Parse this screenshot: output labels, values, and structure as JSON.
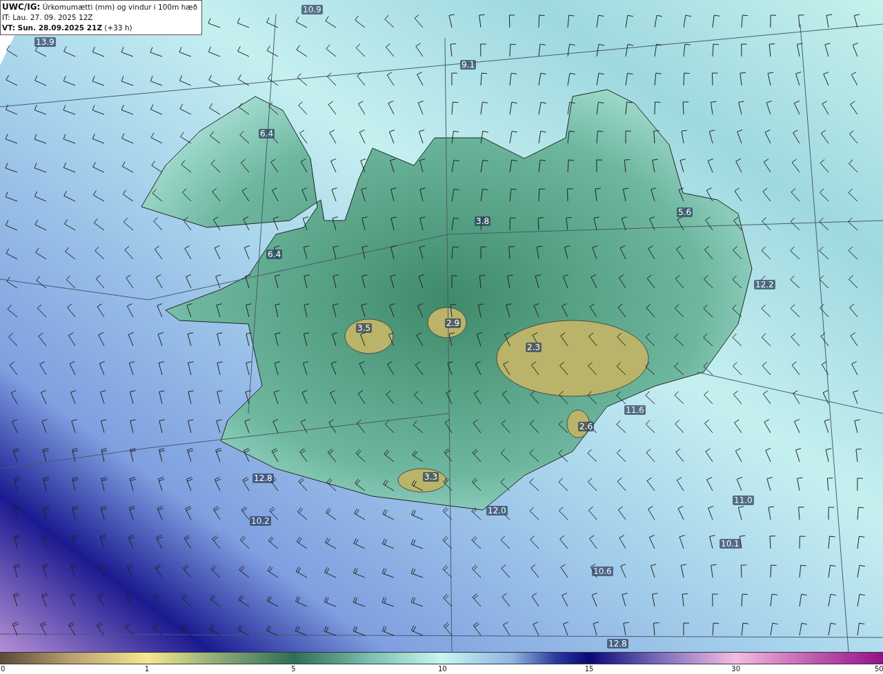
{
  "header": {
    "title": "**UWC/IG:** Úrkomumætti (mm) og vindur i 100m hæð",
    "issue_time": "IT: Lau. 27. 09. 2025 12Z",
    "valid_time": "**VT: Sun. 28.09.2025 21Z** (+33 h)"
  },
  "map": {
    "value_labels": [
      "13.9",
      "10.9",
      "9.1",
      "6.4",
      "6.4",
      "3.8",
      "3.5",
      "2.9",
      "2.3",
      "5.6",
      "12.2",
      "2.6",
      "11.6",
      "3.3",
      "12.8",
      "12.0",
      "10.2",
      "11.0",
      "10.1",
      "10.6",
      "12.8"
    ]
  },
  "colorbar": {
    "ticks": [
      "0",
      "1",
      "5",
      "10",
      "15",
      "30",
      "50"
    ]
  }
}
